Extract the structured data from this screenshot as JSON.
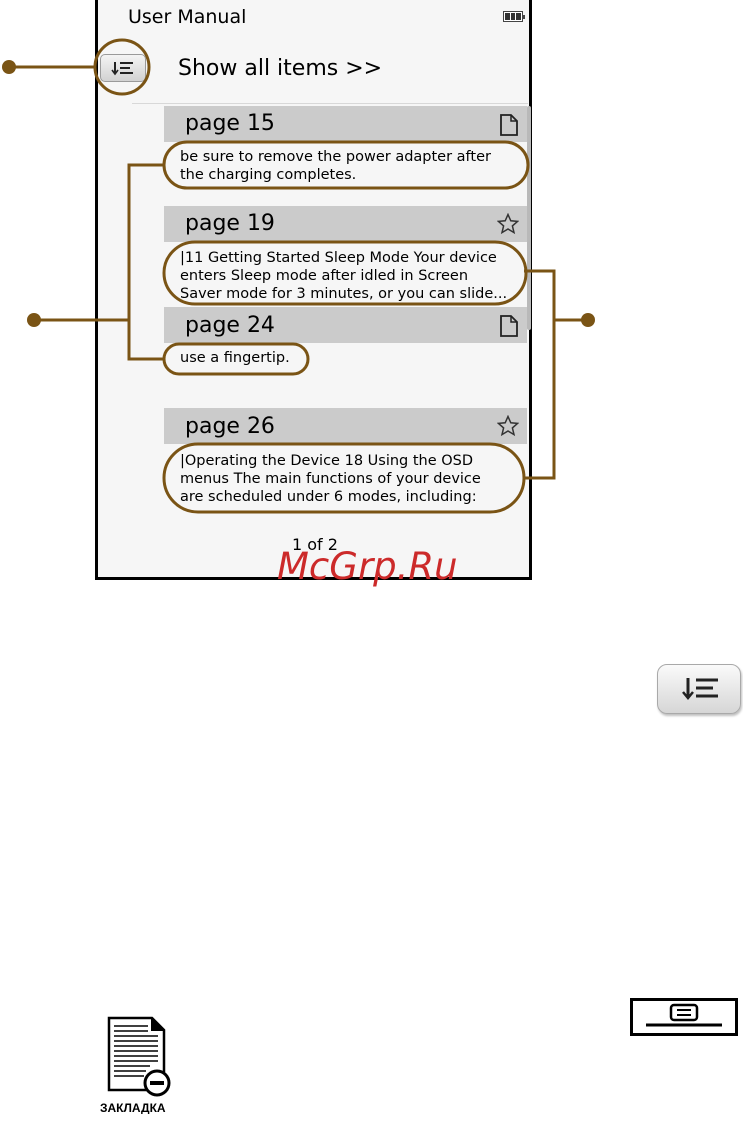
{
  "screen": {
    "title": "User Manual",
    "show_all": "Show all items >>",
    "pager": "1 of 2"
  },
  "results": [
    {
      "page": "page 15",
      "icon": "document-icon",
      "lines": [
        "be sure to remove the power adapter after",
        "the charging completes."
      ]
    },
    {
      "page": "page 19",
      "icon": "star-icon",
      "lines": [
        "|11 Getting Started Sleep Mode Your device",
        "enters Sleep mode after idled in Screen",
        "Saver mode for 3 minutes, or you can slide..."
      ]
    },
    {
      "page": "page 24",
      "icon": "document-icon",
      "lines": [
        "use a fingertip."
      ]
    },
    {
      "page": "page 26",
      "icon": "star-icon",
      "lines": [
        "|Operating the Device 18 Using the OSD",
        "menus The main functions of your device",
        "are scheduled under 6 modes, including:"
      ]
    }
  ],
  "watermark": "McGrp.Ru",
  "icon_caption": "ЗАКЛАДКА",
  "colors": {
    "callout": "#7a5415",
    "header_bar": "#cbcbcb",
    "screen_bg": "#f6f6f6",
    "watermark": "#cc2a2a"
  }
}
